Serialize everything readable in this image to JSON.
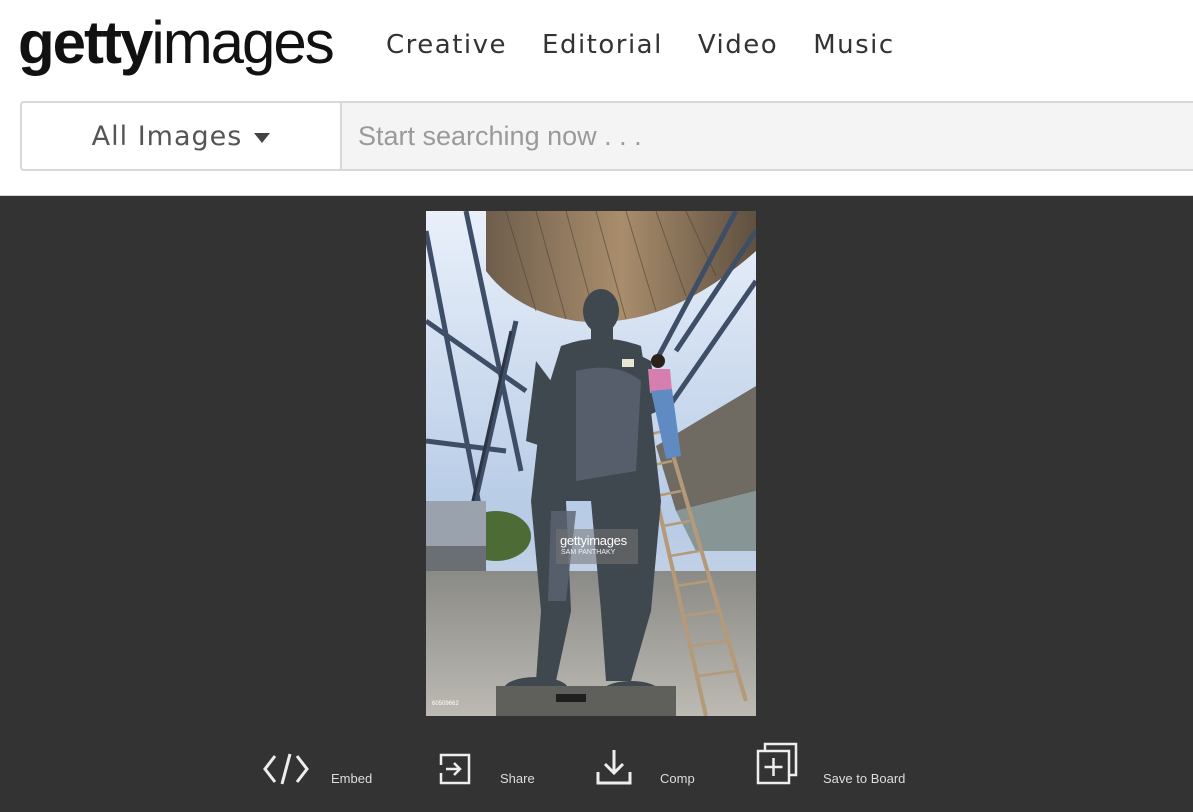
{
  "header": {
    "logo_bold": "getty",
    "logo_light": "images",
    "nav": [
      "Creative",
      "Editorial",
      "Video",
      "Music"
    ]
  },
  "search": {
    "filter_label": "All Images",
    "placeholder": "Start searching now . . ."
  },
  "photo": {
    "watermark_brand": "gettyimages",
    "watermark_credit": "SAM PANTHAKY",
    "image_id": "60509662"
  },
  "actions": {
    "embed": "Embed",
    "share": "Share",
    "comp": "Comp",
    "save": "Save to Board"
  }
}
